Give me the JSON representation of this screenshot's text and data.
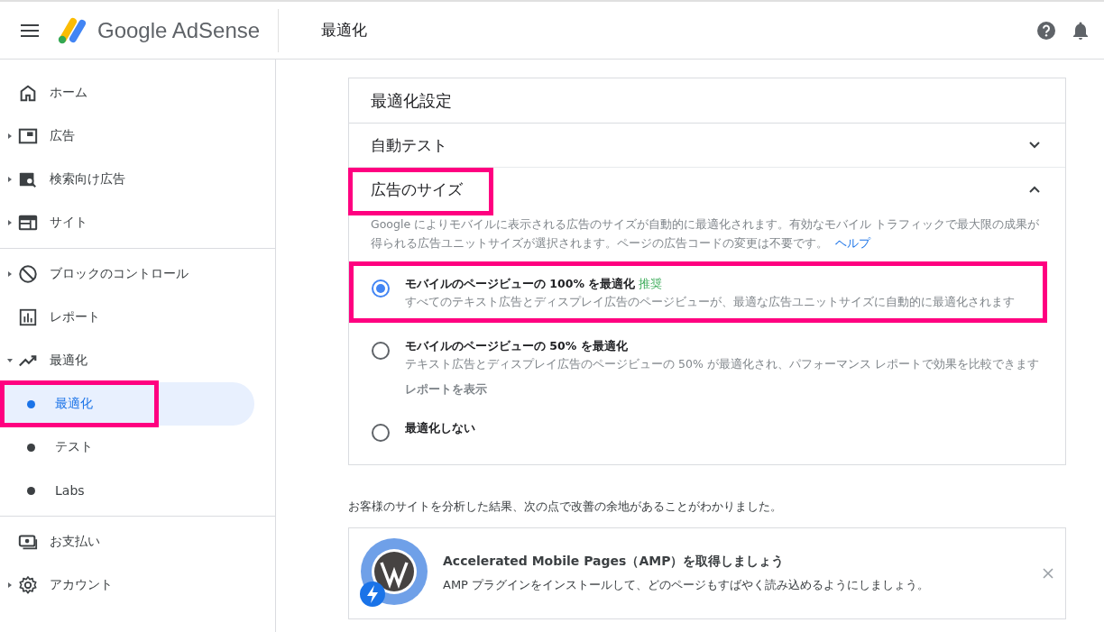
{
  "header": {
    "brand": "Google AdSense",
    "page_title": "最適化"
  },
  "sidebar": {
    "groups": [
      [
        {
          "label": "ホーム",
          "selected": false
        },
        {
          "label": "広告",
          "expanded": false,
          "selected": false
        },
        {
          "label": "検索向け広告",
          "expanded": false,
          "selected": false
        },
        {
          "label": "サイト",
          "expanded": false,
          "selected": false
        }
      ],
      [
        {
          "label": "ブロックのコントロール",
          "expanded": false,
          "selected": false
        },
        {
          "label": "レポート",
          "selected": false
        },
        {
          "label": "最適化",
          "expanded": true,
          "selected": false,
          "children": [
            {
              "label": "最適化",
              "selected": true,
              "highlighted": true
            },
            {
              "label": "テスト",
              "selected": false,
              "highlighted": false
            },
            {
              "label": "Labs",
              "selected": false,
              "highlighted": false
            }
          ]
        }
      ],
      [
        {
          "label": "お支払い",
          "selected": false
        },
        {
          "label": "アカウント",
          "expanded": false,
          "selected": false
        }
      ]
    ]
  },
  "settings": {
    "title": "最適化設定",
    "sections": [
      {
        "title": "自動テスト",
        "expanded": false,
        "highlighted": false
      },
      {
        "title": "広告のサイズ",
        "expanded": true,
        "highlighted": true,
        "description": "Google によりモバイルに表示される広告のサイズが自動的に最適化されます。有効なモバイル トラフィックで最大限の成果が得られる広告ユニットサイズが選択されます。ページの広告コードの変更は不要です。",
        "help_link": "ヘルプ",
        "options": [
          {
            "label": "モバイルのページビューの 100% を最適化",
            "badge": "推奨",
            "description": "すべてのテキスト広告とディスプレイ広告のページビューが、最適な広告ユニットサイズに自動的に最適化されます",
            "selected": true,
            "highlighted": true
          },
          {
            "label": "モバイルのページビューの 50% を最適化",
            "description": "テキスト広告とディスプレイ広告のページビューの 50% が最適化され、パフォーマンス レポートで効果を比較できます",
            "link": "レポートを表示",
            "selected": false,
            "highlighted": false
          },
          {
            "label": "最適化しない",
            "selected": false,
            "highlighted": false
          }
        ]
      }
    ]
  },
  "analysis_note": "お客様のサイトを分析した結果、次の点で改善の余地があることがわかりました。",
  "suggestion": {
    "title": "Accelerated Mobile Pages（AMP）を取得しましょう",
    "body": "AMP プラグインをインストールして、どのページもすばやく読み込めるようにしましょう。"
  }
}
